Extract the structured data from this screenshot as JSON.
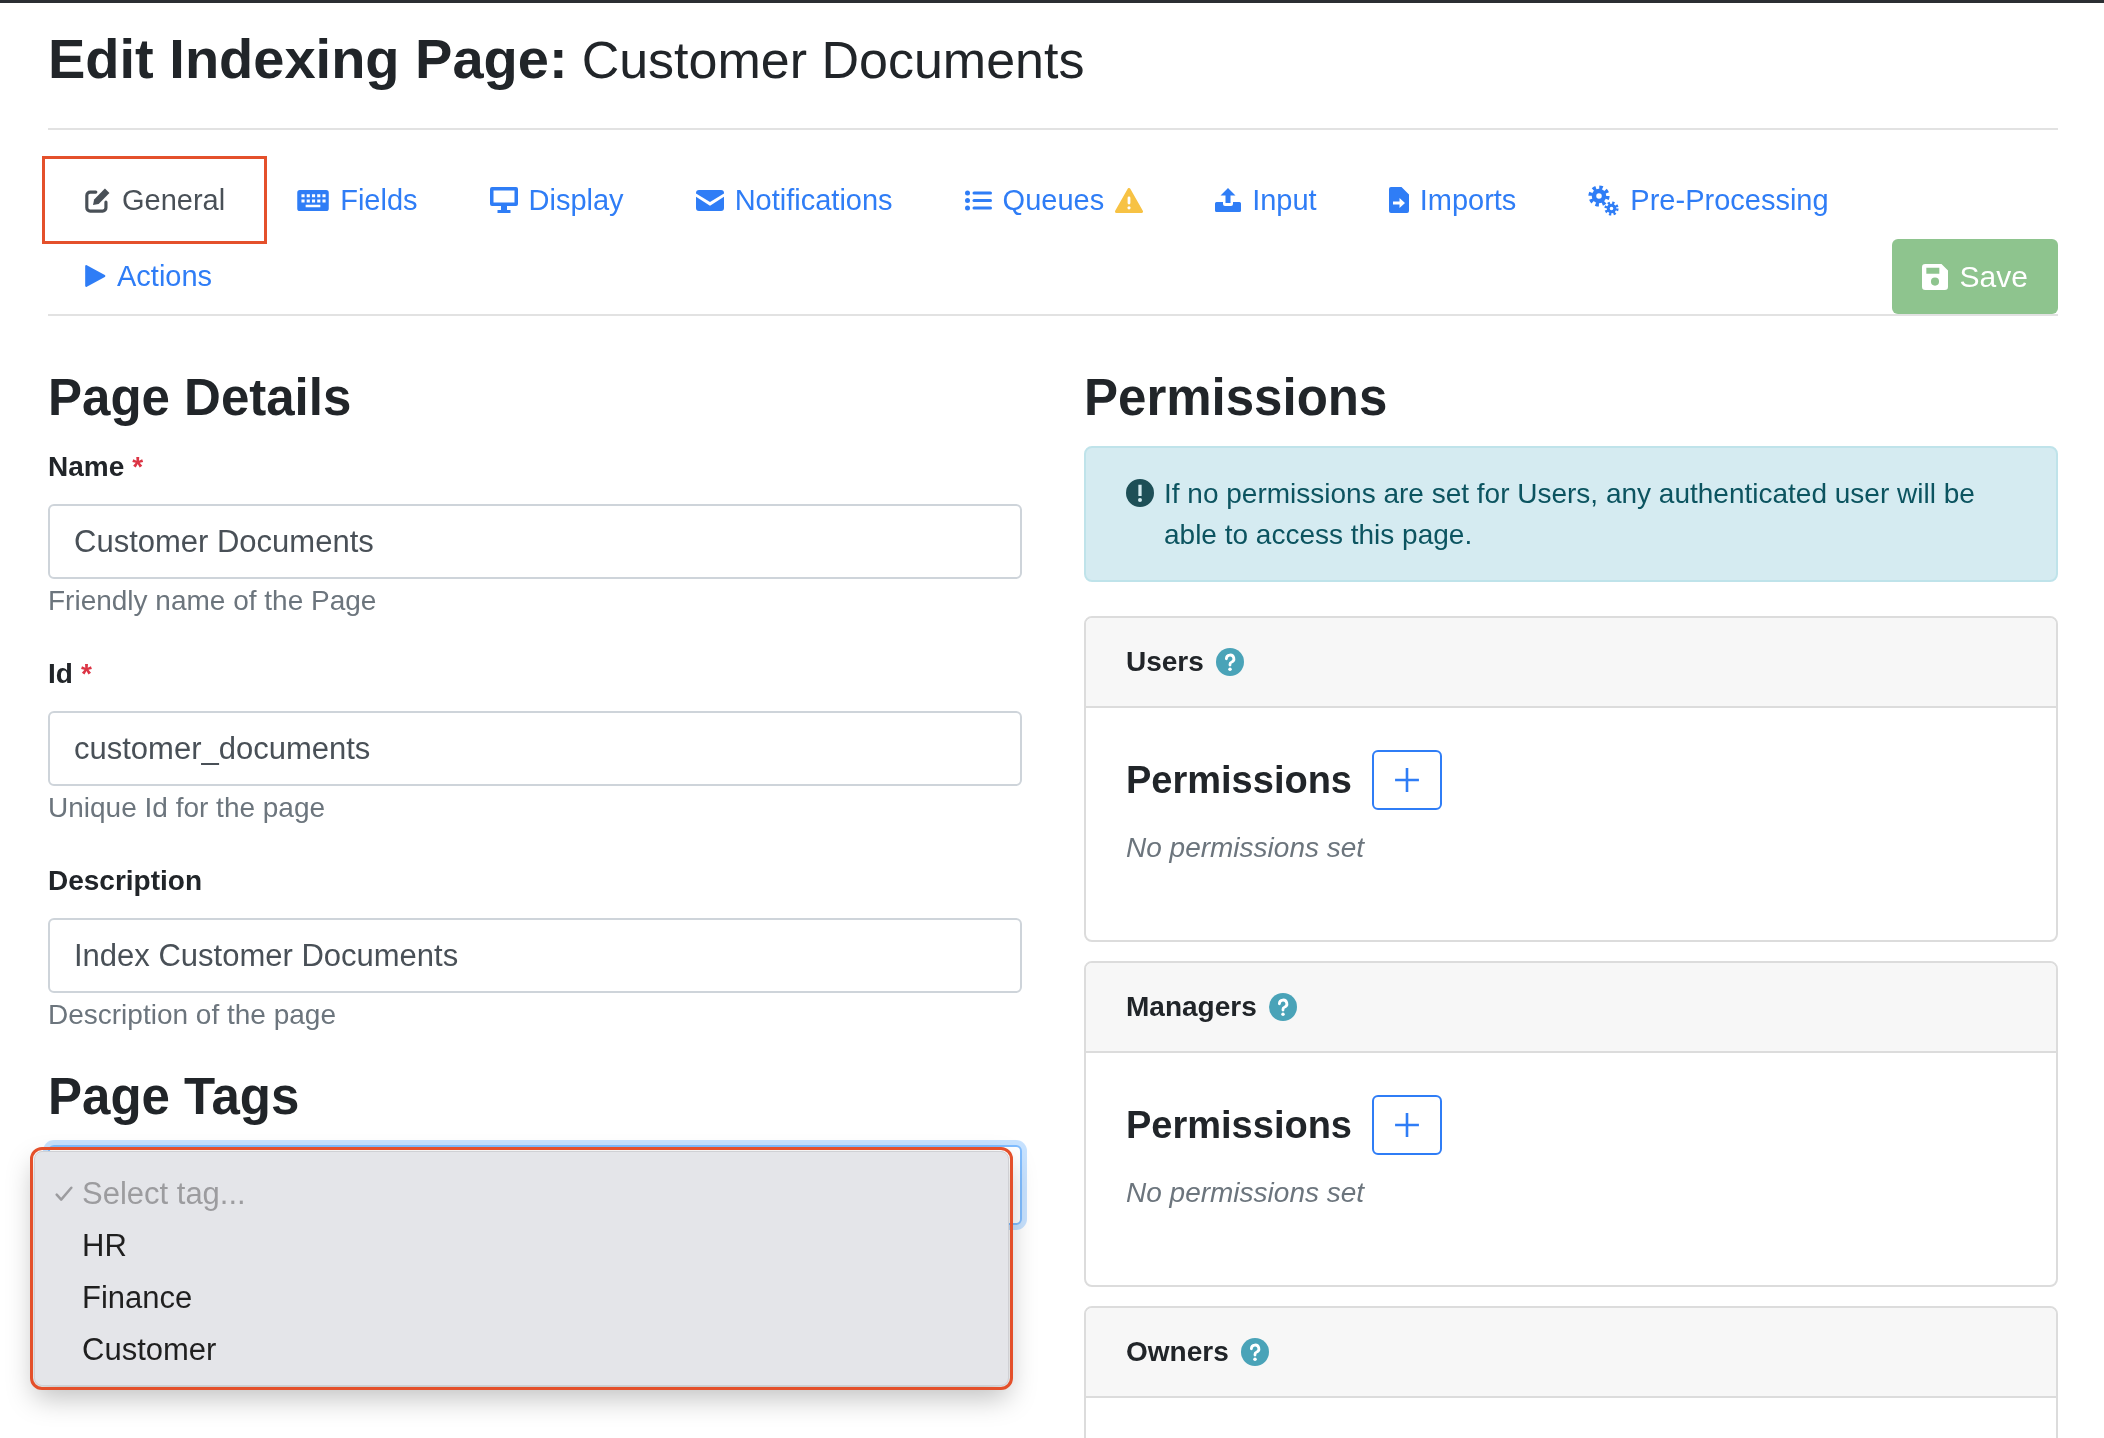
{
  "title": {
    "prefix": "Edit Indexing Page:",
    "name": "Customer Documents"
  },
  "tabs": [
    {
      "label": "General",
      "kind": "general",
      "selected": true,
      "highlighted": true,
      "warning": false
    },
    {
      "label": "Fields",
      "kind": "fields",
      "selected": false,
      "highlighted": false,
      "warning": false
    },
    {
      "label": "Display",
      "kind": "display",
      "selected": false,
      "highlighted": false,
      "warning": false
    },
    {
      "label": "Notifications",
      "kind": "notifications",
      "selected": false,
      "highlighted": false,
      "warning": false
    },
    {
      "label": "Queues",
      "kind": "queues",
      "selected": false,
      "highlighted": false,
      "warning": true
    },
    {
      "label": "Input",
      "kind": "input",
      "selected": false,
      "highlighted": false,
      "warning": false
    },
    {
      "label": "Imports",
      "kind": "imports",
      "selected": false,
      "highlighted": false,
      "warning": false
    },
    {
      "label": "Pre-Processing",
      "kind": "preprocessing",
      "selected": false,
      "highlighted": false,
      "warning": false
    },
    {
      "label": "Actions",
      "kind": "actions",
      "selected": false,
      "highlighted": false,
      "warning": false
    }
  ],
  "save_button": {
    "label": "Save",
    "disabled": true
  },
  "page_details": {
    "heading": "Page Details",
    "fields": [
      {
        "label": "Name",
        "required_mark": "*",
        "value": "Customer Documents",
        "help": "Friendly name of the Page"
      },
      {
        "label": "Id",
        "required_mark": "*",
        "value": "customer_documents",
        "help": "Unique Id for the page"
      },
      {
        "label": "Description",
        "value": "Index Customer Documents",
        "help": "Description of the page"
      }
    ]
  },
  "page_tags": {
    "heading": "Page Tags",
    "select": {
      "open": true,
      "highlighted": true,
      "options": [
        {
          "label": "Select tag...",
          "selected": true,
          "disabled": true
        },
        {
          "label": "HR",
          "selected": false,
          "disabled": false
        },
        {
          "label": "Finance",
          "selected": false,
          "disabled": false
        },
        {
          "label": "Customer",
          "selected": false,
          "disabled": false
        }
      ]
    }
  },
  "permissions": {
    "heading": "Permissions",
    "alert": "If no permissions are set for Users, any authenticated user will be able to access this page.",
    "cards": [
      {
        "title": "Users",
        "heading": "Permissions",
        "empty_text": "No permissions set"
      },
      {
        "title": "Managers",
        "heading": "Permissions",
        "empty_text": "No permissions set"
      },
      {
        "title": "Owners"
      }
    ]
  }
}
